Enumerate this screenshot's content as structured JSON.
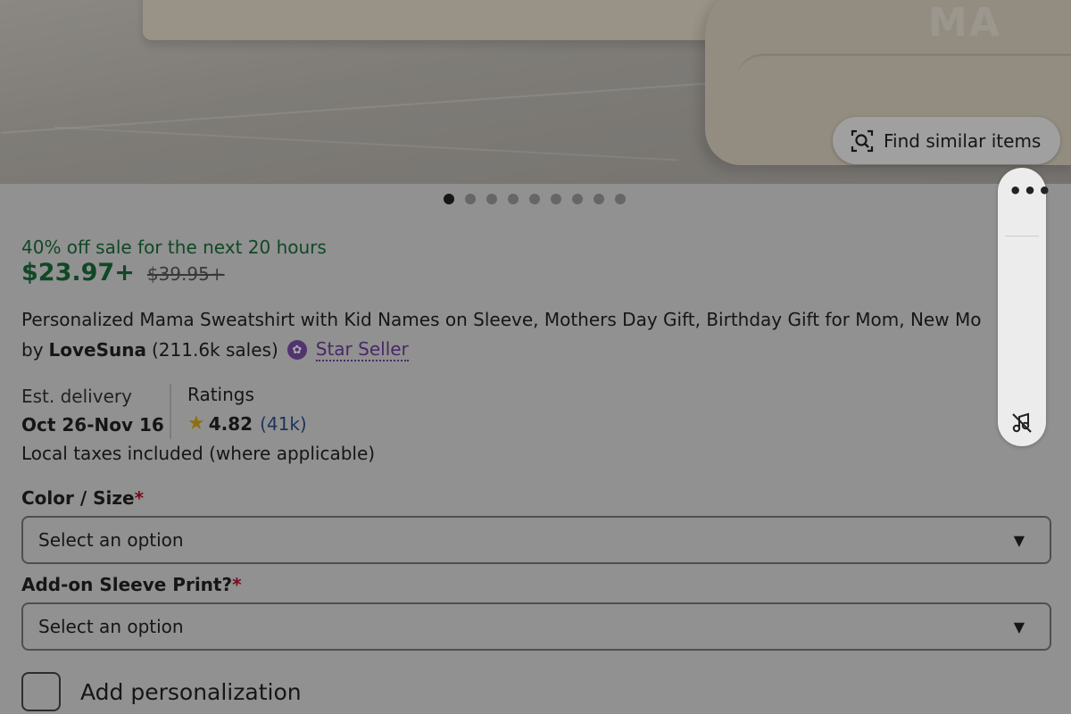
{
  "product": {
    "sale_banner": "40% off sale for the next 20 hours",
    "price": "$23.97+",
    "original_price": "$39.95+",
    "title": "Personalized Mama Sweatshirt with Kid Names on Sleeve, Mothers Day Gift, Birthday Gift for Mom, New Mo",
    "seller_prefix": "by",
    "seller_name": "LoveSuna",
    "seller_sales": "(211.6k sales)",
    "seller_badge": "Star Seller"
  },
  "image": {
    "emboss_text": "MA",
    "find_similar_label": "Find similar items",
    "carousel_count": 9,
    "carousel_active_index": 0
  },
  "info": {
    "delivery_label": "Est. delivery",
    "delivery_value": "Oct 26-Nov 16",
    "ratings_label": "Ratings",
    "rating_value": "4.82",
    "rating_count": "(41k)",
    "taxes_note": "Local taxes included (where applicable)"
  },
  "options": {
    "color_size_label": "Color / Size",
    "color_size_placeholder": "Select an option",
    "sleeve_label": "Add-on Sleeve Print?",
    "sleeve_placeholder": "Select an option",
    "required_marker": "*"
  },
  "personalization": {
    "label": "Add personalization"
  },
  "side_tool": {
    "more_icon": "more-horizontal-icon",
    "mute_icon": "music-off-icon"
  },
  "colors": {
    "sale_green": "#1a6b3a",
    "star_seller_purple": "#6a3e97",
    "required_red": "#b0112b",
    "star_gold": "#d6a520"
  }
}
